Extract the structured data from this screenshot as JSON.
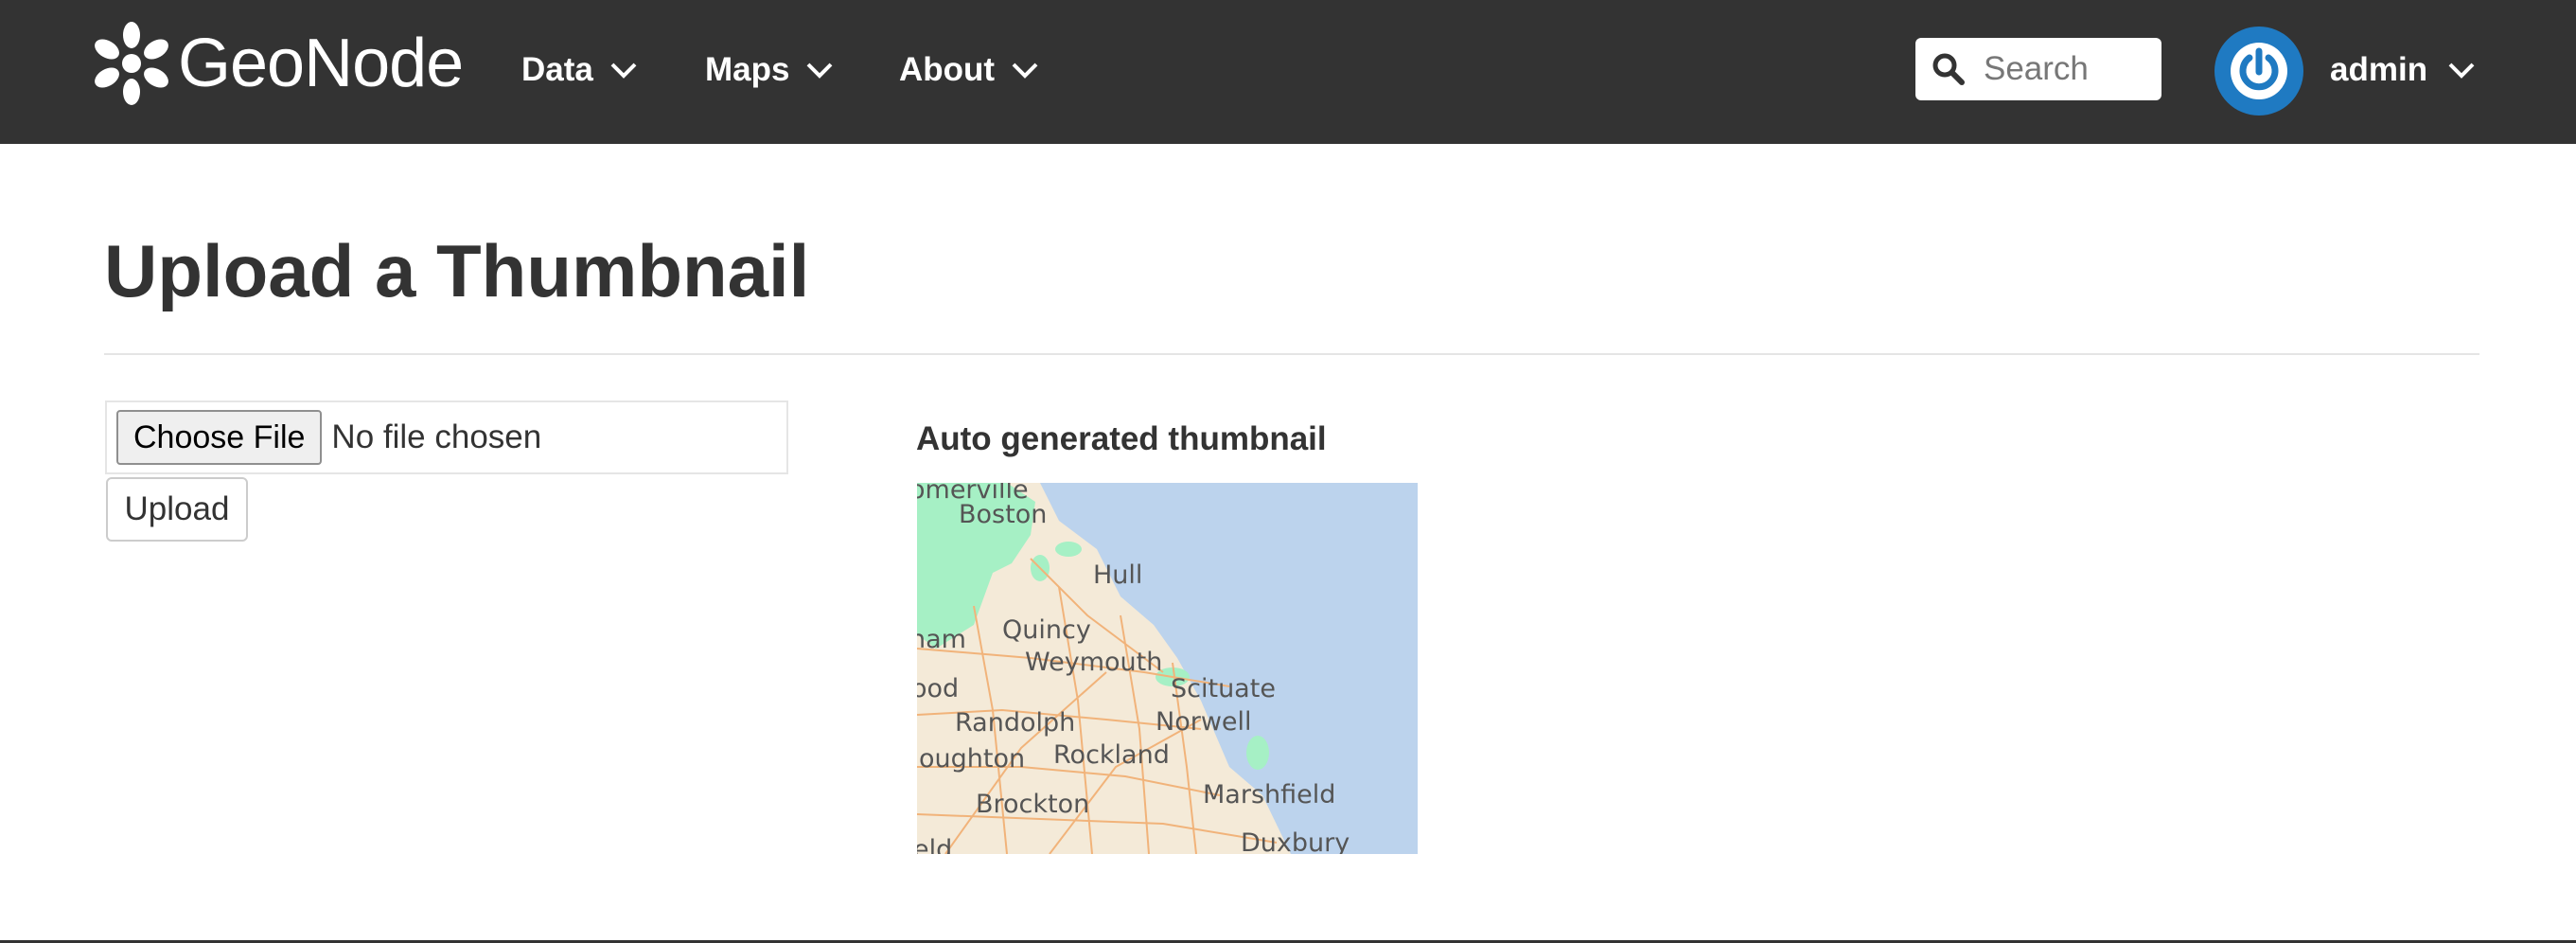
{
  "brand": {
    "name": "GeoNode"
  },
  "nav": {
    "items": [
      {
        "label": "Data"
      },
      {
        "label": "Maps"
      },
      {
        "label": "About"
      }
    ]
  },
  "search": {
    "placeholder": "Search"
  },
  "user": {
    "name": "admin"
  },
  "page": {
    "title": "Upload a Thumbnail",
    "choose_file_label": "Choose File",
    "no_file_text": "No file chosen",
    "upload_label": "Upload",
    "thumbnail_heading": "Auto generated thumbnail"
  },
  "thumbnail_map": {
    "place_labels": [
      "omerville",
      "Boston",
      "Hull",
      "Quincy",
      "Weymouth",
      "ham",
      "Scituate",
      "ood",
      "Randolph",
      "Norwell",
      "Rockland",
      "oughton",
      "Marshfield",
      "Brockton",
      "Duxbury",
      "eld"
    ]
  },
  "colors": {
    "navbar_bg": "#333333",
    "accent_blue": "#1f7ac2",
    "water": "#bcd3ed",
    "land": "#f4ead8",
    "park": "#a6f0c5",
    "road": "#f1b37a"
  },
  "icons": {
    "brand": "geonode-flower-icon",
    "dropdown": "chevron-down-icon",
    "search": "search-icon",
    "avatar": "power-icon"
  }
}
